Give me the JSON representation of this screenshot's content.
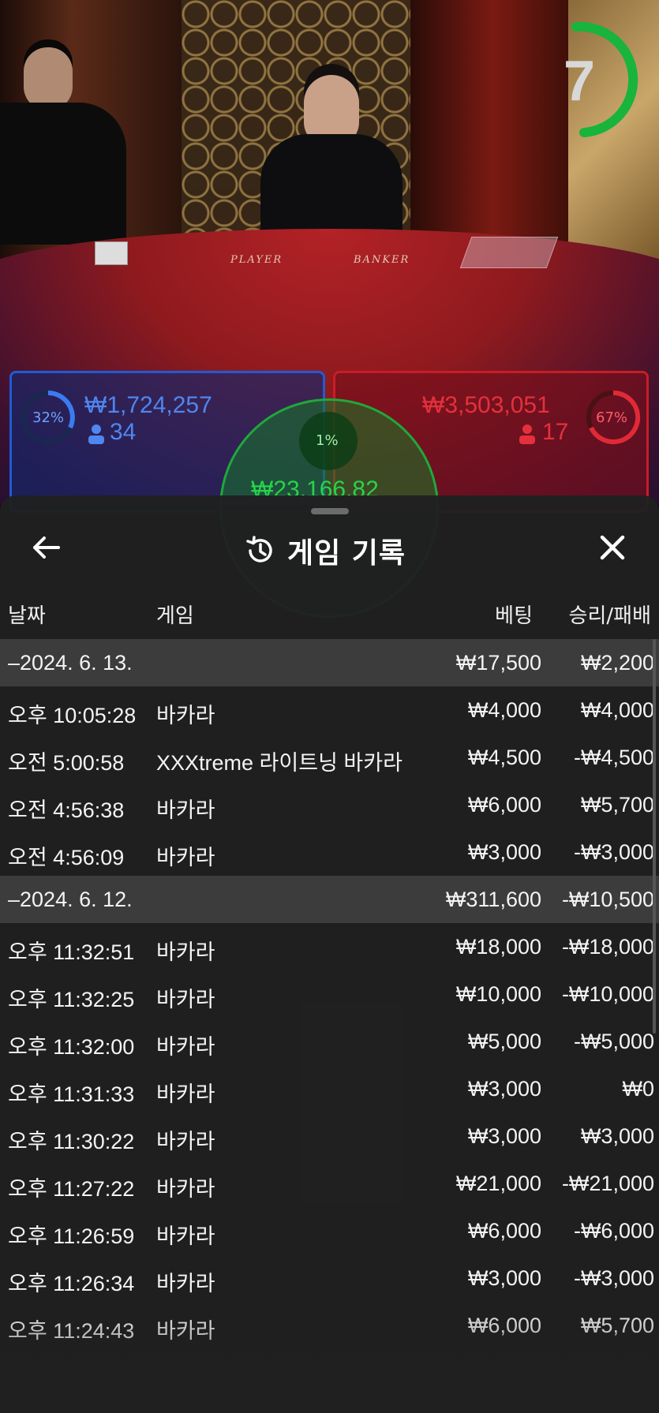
{
  "live": {
    "timer": "7",
    "felt_labels": {
      "player": "PLAYER",
      "banker": "BANKER"
    },
    "player": {
      "percent": "32%",
      "amount": "₩1,724,257",
      "players": "34"
    },
    "banker": {
      "percent": "67%",
      "amount": "₩3,503,051",
      "players": "17"
    },
    "tie": {
      "percent": "1%",
      "amount": "₩23,166,82"
    }
  },
  "colors": {
    "player": "#1e5bd6",
    "banker": "#c81d28",
    "tie": "#1fa83a",
    "timer": "#18b43c"
  },
  "history": {
    "title": "게임 기록",
    "icons": {
      "back": "arrow-left-icon",
      "title": "history-icon",
      "close": "close-icon"
    },
    "columns": {
      "date": "날짜",
      "game": "게임",
      "bet": "베팅",
      "result": "승리/패배"
    },
    "rows": [
      {
        "type": "date",
        "time": "–2024. 6. 13.",
        "game": "",
        "bet": "₩17,500",
        "result": "₩2,200"
      },
      {
        "type": "entry",
        "time": "오후 10:05:28",
        "game": "바카라",
        "bet": "₩4,000",
        "result": "₩4,000"
      },
      {
        "type": "entry",
        "time": "오전 5:00:58",
        "game": "XXXtreme 라이트닝 바카라",
        "bet": "₩4,500",
        "result": "-₩4,500"
      },
      {
        "type": "entry",
        "time": "오전 4:56:38",
        "game": "바카라",
        "bet": "₩6,000",
        "result": "₩5,700"
      },
      {
        "type": "entry",
        "time": "오전 4:56:09",
        "game": "바카라",
        "bet": "₩3,000",
        "result": "-₩3,000"
      },
      {
        "type": "date",
        "time": "–2024. 6. 12.",
        "game": "",
        "bet": "₩311,600",
        "result": "-₩10,500"
      },
      {
        "type": "entry",
        "time": "오후 11:32:51",
        "game": "바카라",
        "bet": "₩18,000",
        "result": "-₩18,000"
      },
      {
        "type": "entry",
        "time": "오후 11:32:25",
        "game": "바카라",
        "bet": "₩10,000",
        "result": "-₩10,000"
      },
      {
        "type": "entry",
        "time": "오후 11:32:00",
        "game": "바카라",
        "bet": "₩5,000",
        "result": "-₩5,000"
      },
      {
        "type": "entry",
        "time": "오후 11:31:33",
        "game": "바카라",
        "bet": "₩3,000",
        "result": "₩0"
      },
      {
        "type": "entry",
        "time": "오후 11:30:22",
        "game": "바카라",
        "bet": "₩3,000",
        "result": "₩3,000"
      },
      {
        "type": "entry",
        "time": "오후 11:27:22",
        "game": "바카라",
        "bet": "₩21,000",
        "result": "-₩21,000"
      },
      {
        "type": "entry",
        "time": "오후 11:26:59",
        "game": "바카라",
        "bet": "₩6,000",
        "result": "-₩6,000"
      },
      {
        "type": "entry",
        "time": "오후 11:26:34",
        "game": "바카라",
        "bet": "₩3,000",
        "result": "-₩3,000"
      },
      {
        "type": "entry",
        "time": "오후 11:24:43",
        "game": "바카라",
        "bet": "₩6,000",
        "result": "₩5,700"
      }
    ]
  }
}
